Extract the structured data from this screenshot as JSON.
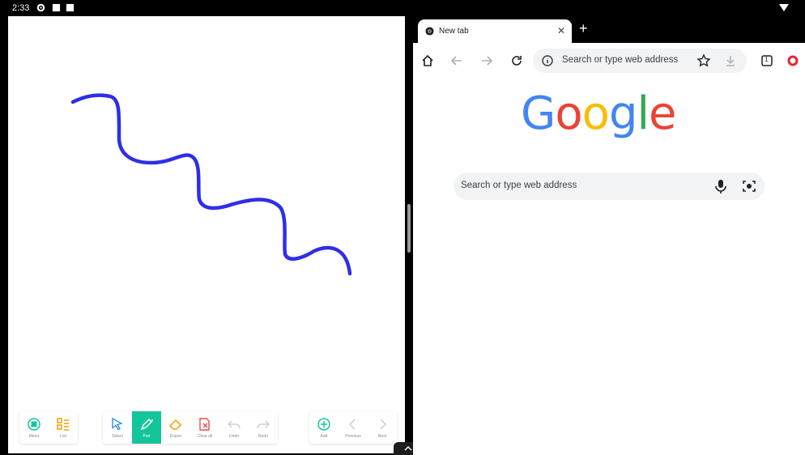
{
  "status_bar": {
    "time": "2:33",
    "icons": [
      "gear-icon",
      "square-icon",
      "square-icon"
    ],
    "right_icon": "wifi-icon"
  },
  "whiteboard": {
    "stroke_color": "#2e2ee8",
    "toolbar_groups": [
      {
        "tools": [
          {
            "label": "Menu",
            "icon": "menu-icon"
          },
          {
            "label": "List",
            "icon": "list-icon"
          }
        ]
      },
      {
        "tools": [
          {
            "label": "Select",
            "icon": "select-icon"
          },
          {
            "label": "Pen",
            "icon": "pen-icon",
            "active": true
          },
          {
            "label": "Eraser",
            "icon": "eraser-icon"
          },
          {
            "label": "Clear all",
            "icon": "clear-all-icon"
          },
          {
            "label": "Undo",
            "icon": "undo-icon"
          },
          {
            "label": "Redo",
            "icon": "redo-icon"
          }
        ]
      },
      {
        "tools": [
          {
            "label": "Add",
            "icon": "add-icon"
          },
          {
            "label": "Previous",
            "icon": "previous-icon"
          },
          {
            "label": "Next",
            "icon": "next-icon"
          }
        ]
      }
    ],
    "accent_color": "#14c59a"
  },
  "browser": {
    "tab": {
      "title": "New tab"
    },
    "new_tab_label": "+",
    "omnibox": {
      "placeholder": "Search or type web address"
    },
    "tab_count": "1",
    "logo": {
      "letters": [
        "G",
        "o",
        "o",
        "g",
        "l",
        "e"
      ],
      "colors": [
        "#4285f4",
        "#ea4335",
        "#fbbc05",
        "#4285f4",
        "#34a853",
        "#ea4335"
      ]
    },
    "search_box": {
      "placeholder": "Search or type web address"
    }
  }
}
